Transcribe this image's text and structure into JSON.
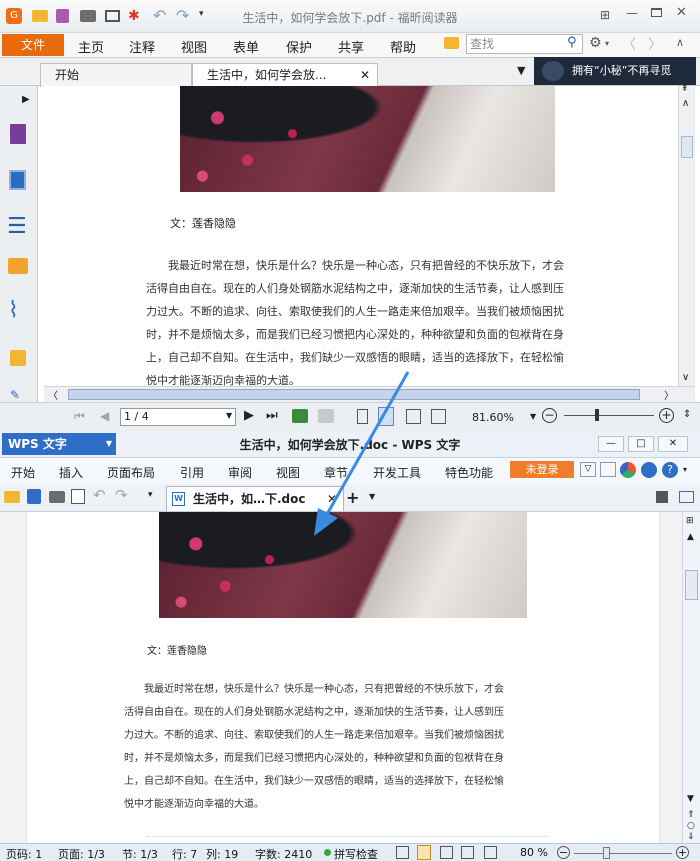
{
  "foxit": {
    "window_title": "生活中，如何学会放下.pdf - 福昕阅读器",
    "menu": {
      "file": "文件",
      "home": "主页",
      "comment": "注释",
      "view": "视图",
      "form": "表单",
      "protect": "保护",
      "share": "共享",
      "help": "帮助"
    },
    "search_placeholder": "查找",
    "tabs": {
      "start": "开始",
      "doc": "生活中，如何学会放..."
    },
    "ad_text": "拥有“小秘”不再寻觅",
    "page_field": "1 / 4",
    "zoom": "81.60%",
    "doc": {
      "author": "文：莲香隐隐",
      "lines": [
        "我最近时常在想，快乐是什么？快乐是一种心态，只有把曾经的不快乐放下，才会",
        "活得自由自在。现在的人们身处钢筋水泥结构之中，逐渐加快的生活节奏，让人感到压",
        "力过大。不断的追求、向往、索取使我们的人生一路走来倍加艰辛。当我们被烦恼困扰",
        "时，并不是烦恼太多，而是我们已经习惯把内心深处的，种种欲望和负面的包袱背在身",
        "上，自己却不自知。在生活中，我们缺少一双感悟的眼睛，适当的选择放下，在轻松愉",
        "悦中才能逐渐迈向幸福的大道。"
      ]
    }
  },
  "wps": {
    "logo": "WPS 文字",
    "window_title": "生活中，如何学会放下.doc - WPS 文字",
    "menu": {
      "start": "开始",
      "insert": "插入",
      "layout": "页面布局",
      "reference": "引用",
      "review": "审阅",
      "view": "视图",
      "section": "章节",
      "dev": "开发工具",
      "special": "特色功能"
    },
    "login": "未登录",
    "doc_tab": "生活中，如…下.doc",
    "doc": {
      "author": "文：莲香隐隐",
      "lines": [
        "我最近时常在想，快乐是什么？快乐是一种心态，只有把曾经的不快乐放下，才会",
        "活得自由自在。现在的人们身处钢筋水泥结构之中，逐渐加快的生活节奏，让人感到压",
        "力过大。不断的追求、向往、索取使我们的人生一路走来倍加艰辛。当我们被烦恼困扰",
        "时，并不是烦恼太多，而是我们已经习惯把内心深处的，种种欲望和负面的包袱背在身",
        "上，自己却不自知。在生活中，我们缺少一双感悟的眼睛，适当的选择放下，在轻松愉",
        "悦中才能逐渐迈向幸福的大道。"
      ]
    },
    "status": {
      "page_no": "页码: 1",
      "page": "页面: 1/3",
      "section": "节: 1/3",
      "row": "行: 7",
      "col": "列: 19",
      "words": "字数: 2410",
      "spell": "拼写检查",
      "zoom": "80 %"
    }
  },
  "colors": {
    "foxit_orange": "#e96a0c",
    "wps_blue": "#2f6ec6",
    "arrow": "#3a8be0",
    "login": "#f07d2c"
  }
}
